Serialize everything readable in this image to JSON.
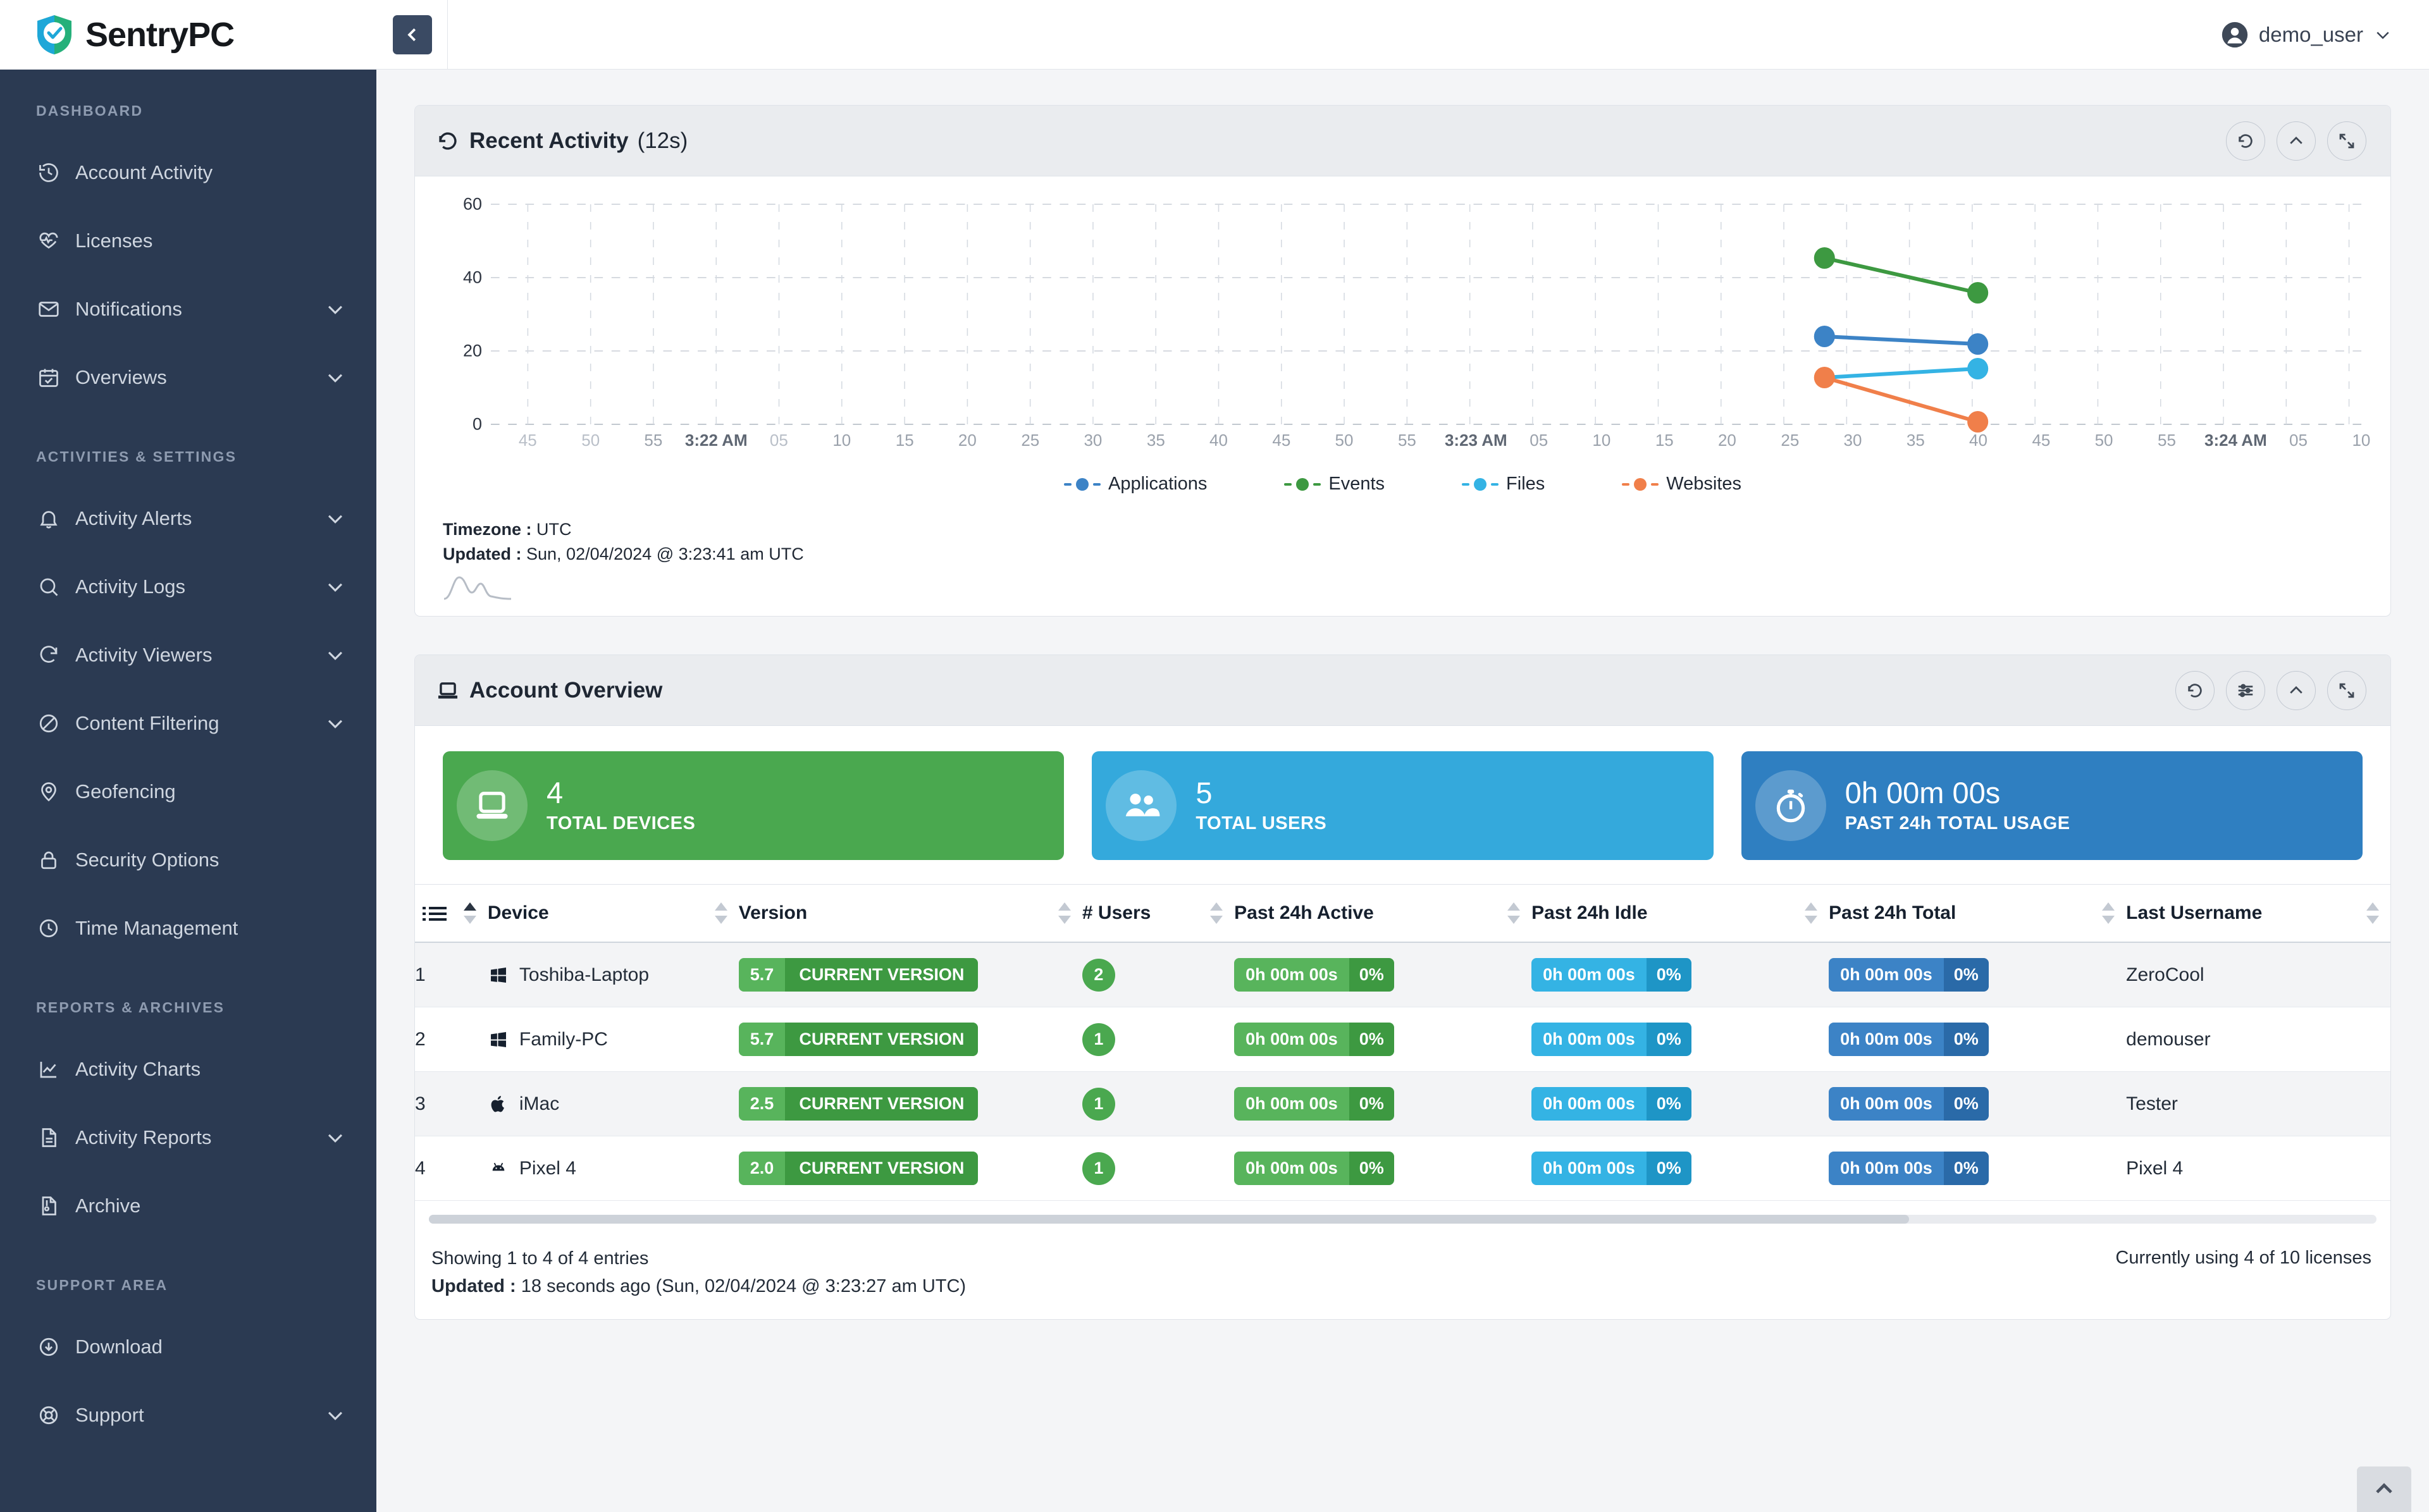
{
  "brand": {
    "name": "SentryPC"
  },
  "topbar": {
    "username": "demo_user"
  },
  "sidebar": {
    "sections": [
      {
        "title": "DASHBOARD",
        "items": [
          {
            "label": "Account Activity",
            "icon": "history-icon",
            "expandable": false
          },
          {
            "label": "Licenses",
            "icon": "pulse-heart-icon",
            "expandable": false
          },
          {
            "label": "Notifications",
            "icon": "envelope-icon",
            "expandable": true
          },
          {
            "label": "Overviews",
            "icon": "calendar-check-icon",
            "expandable": true
          }
        ]
      },
      {
        "title": "ACTIVITIES & SETTINGS",
        "items": [
          {
            "label": "Activity Alerts",
            "icon": "bell-icon",
            "expandable": true
          },
          {
            "label": "Activity Logs",
            "icon": "search-icon",
            "expandable": true
          },
          {
            "label": "Activity Viewers",
            "icon": "refresh-arrow-icon",
            "expandable": true
          },
          {
            "label": "Content Filtering",
            "icon": "block-icon",
            "expandable": true
          },
          {
            "label": "Geofencing",
            "icon": "map-pin-icon",
            "expandable": false
          },
          {
            "label": "Security Options",
            "icon": "lock-icon",
            "expandable": false
          },
          {
            "label": "Time Management",
            "icon": "clock-icon",
            "expandable": false
          }
        ]
      },
      {
        "title": "REPORTS & ARCHIVES",
        "items": [
          {
            "label": "Activity Charts",
            "icon": "line-chart-icon",
            "expandable": false
          },
          {
            "label": "Activity Reports",
            "icon": "document-icon",
            "expandable": true
          },
          {
            "label": "Archive",
            "icon": "archive-icon",
            "expandable": false
          }
        ]
      },
      {
        "title": "SUPPORT AREA",
        "items": [
          {
            "label": "Download",
            "icon": "download-circle-icon",
            "expandable": false
          },
          {
            "label": "Support",
            "icon": "lifebuoy-icon",
            "expandable": true
          }
        ]
      }
    ]
  },
  "recent_activity": {
    "title": "Recent Activity",
    "title_suffix": "(12s)",
    "timezone_label": "Timezone :",
    "timezone_value": "UTC",
    "updated_label": "Updated :",
    "updated_value": "Sun, 02/04/2024 @ 3:23:41 am UTC",
    "buttons": [
      "refresh-icon",
      "collapse-icon",
      "expand-icon"
    ]
  },
  "chart_data": {
    "type": "line",
    "title": "Recent Activity",
    "xlabel": "",
    "ylabel": "",
    "ylim": [
      0,
      60
    ],
    "yticks": [
      0,
      20,
      40,
      60
    ],
    "grid": true,
    "legend_position": "bottom",
    "x_tick_labels": [
      "45",
      "50",
      "55",
      "3:22 AM",
      "05",
      "10",
      "15",
      "20",
      "25",
      "30",
      "35",
      "40",
      "45",
      "50",
      "55",
      "3:23 AM",
      "05",
      "10",
      "15",
      "20",
      "25",
      "30",
      "35",
      "40",
      "45",
      "50",
      "55",
      "3:24 AM",
      "05",
      "10"
    ],
    "series": [
      {
        "name": "Applications",
        "color": "#3c83c6",
        "points": [
          {
            "x": "3:23 AM 25",
            "y": 24
          },
          {
            "x": "3:23 AM 41",
            "y": 22
          }
        ]
      },
      {
        "name": "Events",
        "color": "#3d9941",
        "points": [
          {
            "x": "3:23 AM 25",
            "y": 44
          },
          {
            "x": "3:23 AM 41",
            "y": 35
          }
        ]
      },
      {
        "name": "Files",
        "color": "#34b3e4",
        "points": [
          {
            "x": "3:23 AM 25",
            "y": 13
          },
          {
            "x": "3:23 AM 41",
            "y": 15
          }
        ]
      },
      {
        "name": "Websites",
        "color": "#f07f4a",
        "points": [
          {
            "x": "3:23 AM 25",
            "y": 13
          },
          {
            "x": "3:23 AM 41",
            "y": 1
          }
        ]
      }
    ]
  },
  "account_overview": {
    "title": "Account Overview",
    "buttons": [
      "refresh-icon",
      "filter-icon",
      "collapse-icon",
      "expand-icon"
    ],
    "stats": [
      {
        "value": "4",
        "label": "TOTAL DEVICES",
        "icon": "laptop-icon",
        "color": "#4aa84f"
      },
      {
        "value": "5",
        "label": "TOTAL USERS",
        "icon": "users-icon",
        "color": "#34a9dc"
      },
      {
        "value": "0h 00m 00s",
        "label": "PAST 24h TOTAL USAGE",
        "icon": "stopwatch-icon",
        "color": "#2f7fc1"
      }
    ],
    "columns": [
      {
        "key": "num",
        "label": "",
        "icon": "list-icon",
        "sorted": "asc"
      },
      {
        "key": "device",
        "label": "Device"
      },
      {
        "key": "version",
        "label": "Version"
      },
      {
        "key": "users",
        "label": "# Users"
      },
      {
        "key": "active",
        "label": "Past 24h Active"
      },
      {
        "key": "idle",
        "label": "Past 24h Idle"
      },
      {
        "key": "total",
        "label": "Past 24h Total"
      },
      {
        "key": "last_username",
        "label": "Last Username"
      }
    ],
    "rows": [
      {
        "num": "1",
        "device": "Toshiba-Laptop",
        "device_icon": "windows-icon",
        "version": "5.7",
        "version_status": "CURRENT VERSION",
        "users": "2",
        "active": "0h 00m 00s",
        "active_pct": "0%",
        "idle": "0h 00m 00s",
        "idle_pct": "0%",
        "total": "0h 00m 00s",
        "total_pct": "0%",
        "last_username": "ZeroCool"
      },
      {
        "num": "2",
        "device": "Family-PC",
        "device_icon": "windows-icon",
        "version": "5.7",
        "version_status": "CURRENT VERSION",
        "users": "1",
        "active": "0h 00m 00s",
        "active_pct": "0%",
        "idle": "0h 00m 00s",
        "idle_pct": "0%",
        "total": "0h 00m 00s",
        "total_pct": "0%",
        "last_username": "demouser"
      },
      {
        "num": "3",
        "device": "iMac",
        "device_icon": "apple-icon",
        "version": "2.5",
        "version_status": "CURRENT VERSION",
        "users": "1",
        "active": "0h 00m 00s",
        "active_pct": "0%",
        "idle": "0h 00m 00s",
        "idle_pct": "0%",
        "total": "0h 00m 00s",
        "total_pct": "0%",
        "last_username": "Tester"
      },
      {
        "num": "4",
        "device": "Pixel 4",
        "device_icon": "android-icon",
        "version": "2.0",
        "version_status": "CURRENT VERSION",
        "users": "1",
        "active": "0h 00m 00s",
        "active_pct": "0%",
        "idle": "0h 00m 00s",
        "idle_pct": "0%",
        "total": "0h 00m 00s",
        "total_pct": "0%",
        "last_username": "Pixel 4"
      }
    ],
    "footer": {
      "showing": "Showing 1 to 4 of 4 entries",
      "updated_label": "Updated :",
      "updated_value": "18 seconds ago (Sun, 02/04/2024 @ 3:23:27 am UTC)",
      "licenses": "Currently using 4 of 10 licenses"
    }
  }
}
